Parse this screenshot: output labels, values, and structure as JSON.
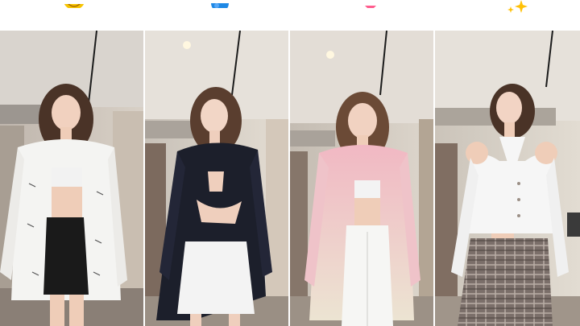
{
  "title": "",
  "emojis": [
    {
      "icon": "smiley-face-emoji",
      "color": "#f7c400"
    },
    {
      "icon": "blue-circle-emoji",
      "color": "#1e88e5"
    },
    {
      "icon": "pink-heart-emoji",
      "color": "#ff5c8d"
    },
    {
      "icon": "sparkles-emoji",
      "color": "#ffc107"
    }
  ],
  "panels": [
    {
      "outfit": "white-blazer-black-skirt",
      "blazer": "#f4f4f2",
      "bottom": "#1a1a1a",
      "top": "#f2f2f2"
    },
    {
      "outfit": "black-cutout-blazer-white-skirt",
      "blazer": "#1c1f2b",
      "bottom": "#f3f3f3",
      "top": "#1c1f2b"
    },
    {
      "outfit": "pink-ombre-blazer-white-pants",
      "blazer": "#f1b8c3",
      "bottom": "#f6f6f4",
      "top": "#f3f3f3"
    },
    {
      "outfit": "white-halter-top-plaid-pants",
      "blazer": "#f6f6f6",
      "bottom": "#7b6f6a",
      "top": "#f6f6f6"
    }
  ]
}
